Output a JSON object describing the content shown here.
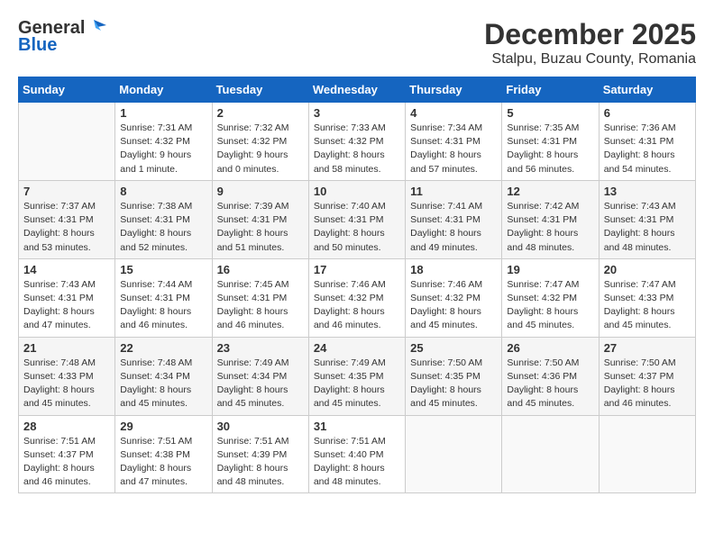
{
  "header": {
    "logo_general": "General",
    "logo_blue": "Blue",
    "month_title": "December 2025",
    "location": "Stalpu, Buzau County, Romania"
  },
  "days_of_week": [
    "Sunday",
    "Monday",
    "Tuesday",
    "Wednesday",
    "Thursday",
    "Friday",
    "Saturday"
  ],
  "weeks": [
    {
      "days": [
        {
          "num": "",
          "sunrise": "",
          "sunset": "",
          "daylight": ""
        },
        {
          "num": "1",
          "sunrise": "Sunrise: 7:31 AM",
          "sunset": "Sunset: 4:32 PM",
          "daylight": "Daylight: 9 hours and 1 minute."
        },
        {
          "num": "2",
          "sunrise": "Sunrise: 7:32 AM",
          "sunset": "Sunset: 4:32 PM",
          "daylight": "Daylight: 9 hours and 0 minutes."
        },
        {
          "num": "3",
          "sunrise": "Sunrise: 7:33 AM",
          "sunset": "Sunset: 4:32 PM",
          "daylight": "Daylight: 8 hours and 58 minutes."
        },
        {
          "num": "4",
          "sunrise": "Sunrise: 7:34 AM",
          "sunset": "Sunset: 4:31 PM",
          "daylight": "Daylight: 8 hours and 57 minutes."
        },
        {
          "num": "5",
          "sunrise": "Sunrise: 7:35 AM",
          "sunset": "Sunset: 4:31 PM",
          "daylight": "Daylight: 8 hours and 56 minutes."
        },
        {
          "num": "6",
          "sunrise": "Sunrise: 7:36 AM",
          "sunset": "Sunset: 4:31 PM",
          "daylight": "Daylight: 8 hours and 54 minutes."
        }
      ]
    },
    {
      "days": [
        {
          "num": "7",
          "sunrise": "Sunrise: 7:37 AM",
          "sunset": "Sunset: 4:31 PM",
          "daylight": "Daylight: 8 hours and 53 minutes."
        },
        {
          "num": "8",
          "sunrise": "Sunrise: 7:38 AM",
          "sunset": "Sunset: 4:31 PM",
          "daylight": "Daylight: 8 hours and 52 minutes."
        },
        {
          "num": "9",
          "sunrise": "Sunrise: 7:39 AM",
          "sunset": "Sunset: 4:31 PM",
          "daylight": "Daylight: 8 hours and 51 minutes."
        },
        {
          "num": "10",
          "sunrise": "Sunrise: 7:40 AM",
          "sunset": "Sunset: 4:31 PM",
          "daylight": "Daylight: 8 hours and 50 minutes."
        },
        {
          "num": "11",
          "sunrise": "Sunrise: 7:41 AM",
          "sunset": "Sunset: 4:31 PM",
          "daylight": "Daylight: 8 hours and 49 minutes."
        },
        {
          "num": "12",
          "sunrise": "Sunrise: 7:42 AM",
          "sunset": "Sunset: 4:31 PM",
          "daylight": "Daylight: 8 hours and 48 minutes."
        },
        {
          "num": "13",
          "sunrise": "Sunrise: 7:43 AM",
          "sunset": "Sunset: 4:31 PM",
          "daylight": "Daylight: 8 hours and 48 minutes."
        }
      ]
    },
    {
      "days": [
        {
          "num": "14",
          "sunrise": "Sunrise: 7:43 AM",
          "sunset": "Sunset: 4:31 PM",
          "daylight": "Daylight: 8 hours and 47 minutes."
        },
        {
          "num": "15",
          "sunrise": "Sunrise: 7:44 AM",
          "sunset": "Sunset: 4:31 PM",
          "daylight": "Daylight: 8 hours and 46 minutes."
        },
        {
          "num": "16",
          "sunrise": "Sunrise: 7:45 AM",
          "sunset": "Sunset: 4:31 PM",
          "daylight": "Daylight: 8 hours and 46 minutes."
        },
        {
          "num": "17",
          "sunrise": "Sunrise: 7:46 AM",
          "sunset": "Sunset: 4:32 PM",
          "daylight": "Daylight: 8 hours and 46 minutes."
        },
        {
          "num": "18",
          "sunrise": "Sunrise: 7:46 AM",
          "sunset": "Sunset: 4:32 PM",
          "daylight": "Daylight: 8 hours and 45 minutes."
        },
        {
          "num": "19",
          "sunrise": "Sunrise: 7:47 AM",
          "sunset": "Sunset: 4:32 PM",
          "daylight": "Daylight: 8 hours and 45 minutes."
        },
        {
          "num": "20",
          "sunrise": "Sunrise: 7:47 AM",
          "sunset": "Sunset: 4:33 PM",
          "daylight": "Daylight: 8 hours and 45 minutes."
        }
      ]
    },
    {
      "days": [
        {
          "num": "21",
          "sunrise": "Sunrise: 7:48 AM",
          "sunset": "Sunset: 4:33 PM",
          "daylight": "Daylight: 8 hours and 45 minutes."
        },
        {
          "num": "22",
          "sunrise": "Sunrise: 7:48 AM",
          "sunset": "Sunset: 4:34 PM",
          "daylight": "Daylight: 8 hours and 45 minutes."
        },
        {
          "num": "23",
          "sunrise": "Sunrise: 7:49 AM",
          "sunset": "Sunset: 4:34 PM",
          "daylight": "Daylight: 8 hours and 45 minutes."
        },
        {
          "num": "24",
          "sunrise": "Sunrise: 7:49 AM",
          "sunset": "Sunset: 4:35 PM",
          "daylight": "Daylight: 8 hours and 45 minutes."
        },
        {
          "num": "25",
          "sunrise": "Sunrise: 7:50 AM",
          "sunset": "Sunset: 4:35 PM",
          "daylight": "Daylight: 8 hours and 45 minutes."
        },
        {
          "num": "26",
          "sunrise": "Sunrise: 7:50 AM",
          "sunset": "Sunset: 4:36 PM",
          "daylight": "Daylight: 8 hours and 45 minutes."
        },
        {
          "num": "27",
          "sunrise": "Sunrise: 7:50 AM",
          "sunset": "Sunset: 4:37 PM",
          "daylight": "Daylight: 8 hours and 46 minutes."
        }
      ]
    },
    {
      "days": [
        {
          "num": "28",
          "sunrise": "Sunrise: 7:51 AM",
          "sunset": "Sunset: 4:37 PM",
          "daylight": "Daylight: 8 hours and 46 minutes."
        },
        {
          "num": "29",
          "sunrise": "Sunrise: 7:51 AM",
          "sunset": "Sunset: 4:38 PM",
          "daylight": "Daylight: 8 hours and 47 minutes."
        },
        {
          "num": "30",
          "sunrise": "Sunrise: 7:51 AM",
          "sunset": "Sunset: 4:39 PM",
          "daylight": "Daylight: 8 hours and 48 minutes."
        },
        {
          "num": "31",
          "sunrise": "Sunrise: 7:51 AM",
          "sunset": "Sunset: 4:40 PM",
          "daylight": "Daylight: 8 hours and 48 minutes."
        },
        {
          "num": "",
          "sunrise": "",
          "sunset": "",
          "daylight": ""
        },
        {
          "num": "",
          "sunrise": "",
          "sunset": "",
          "daylight": ""
        },
        {
          "num": "",
          "sunrise": "",
          "sunset": "",
          "daylight": ""
        }
      ]
    }
  ]
}
